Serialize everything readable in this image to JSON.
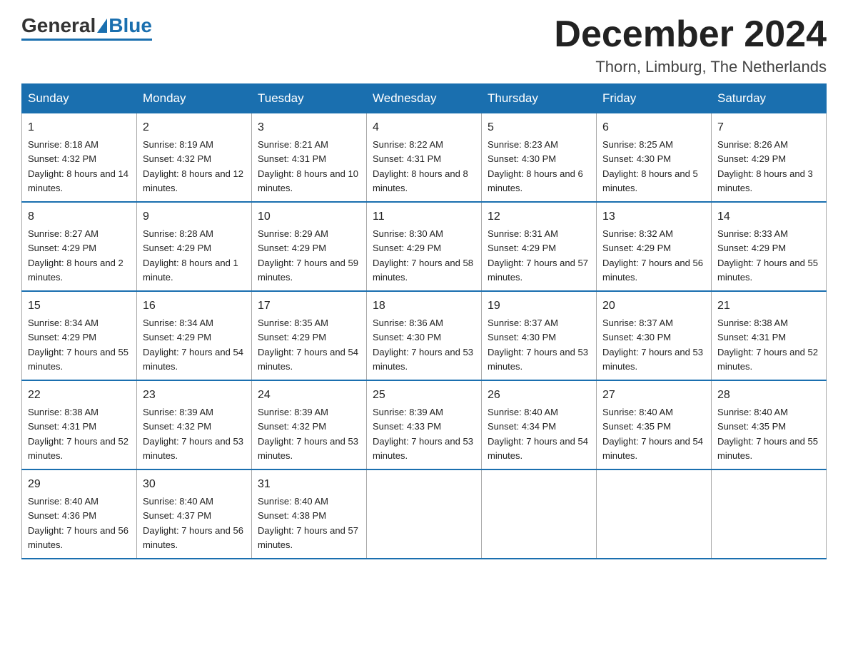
{
  "logo": {
    "text_general": "General",
    "text_blue": "Blue"
  },
  "header": {
    "month_year": "December 2024",
    "location": "Thorn, Limburg, The Netherlands"
  },
  "columns": [
    "Sunday",
    "Monday",
    "Tuesday",
    "Wednesday",
    "Thursday",
    "Friday",
    "Saturday"
  ],
  "weeks": [
    [
      {
        "day": "1",
        "sunrise": "8:18 AM",
        "sunset": "4:32 PM",
        "daylight": "8 hours and 14 minutes."
      },
      {
        "day": "2",
        "sunrise": "8:19 AM",
        "sunset": "4:32 PM",
        "daylight": "8 hours and 12 minutes."
      },
      {
        "day": "3",
        "sunrise": "8:21 AM",
        "sunset": "4:31 PM",
        "daylight": "8 hours and 10 minutes."
      },
      {
        "day": "4",
        "sunrise": "8:22 AM",
        "sunset": "4:31 PM",
        "daylight": "8 hours and 8 minutes."
      },
      {
        "day": "5",
        "sunrise": "8:23 AM",
        "sunset": "4:30 PM",
        "daylight": "8 hours and 6 minutes."
      },
      {
        "day": "6",
        "sunrise": "8:25 AM",
        "sunset": "4:30 PM",
        "daylight": "8 hours and 5 minutes."
      },
      {
        "day": "7",
        "sunrise": "8:26 AM",
        "sunset": "4:29 PM",
        "daylight": "8 hours and 3 minutes."
      }
    ],
    [
      {
        "day": "8",
        "sunrise": "8:27 AM",
        "sunset": "4:29 PM",
        "daylight": "8 hours and 2 minutes."
      },
      {
        "day": "9",
        "sunrise": "8:28 AM",
        "sunset": "4:29 PM",
        "daylight": "8 hours and 1 minute."
      },
      {
        "day": "10",
        "sunrise": "8:29 AM",
        "sunset": "4:29 PM",
        "daylight": "7 hours and 59 minutes."
      },
      {
        "day": "11",
        "sunrise": "8:30 AM",
        "sunset": "4:29 PM",
        "daylight": "7 hours and 58 minutes."
      },
      {
        "day": "12",
        "sunrise": "8:31 AM",
        "sunset": "4:29 PM",
        "daylight": "7 hours and 57 minutes."
      },
      {
        "day": "13",
        "sunrise": "8:32 AM",
        "sunset": "4:29 PM",
        "daylight": "7 hours and 56 minutes."
      },
      {
        "day": "14",
        "sunrise": "8:33 AM",
        "sunset": "4:29 PM",
        "daylight": "7 hours and 55 minutes."
      }
    ],
    [
      {
        "day": "15",
        "sunrise": "8:34 AM",
        "sunset": "4:29 PM",
        "daylight": "7 hours and 55 minutes."
      },
      {
        "day": "16",
        "sunrise": "8:34 AM",
        "sunset": "4:29 PM",
        "daylight": "7 hours and 54 minutes."
      },
      {
        "day": "17",
        "sunrise": "8:35 AM",
        "sunset": "4:29 PM",
        "daylight": "7 hours and 54 minutes."
      },
      {
        "day": "18",
        "sunrise": "8:36 AM",
        "sunset": "4:30 PM",
        "daylight": "7 hours and 53 minutes."
      },
      {
        "day": "19",
        "sunrise": "8:37 AM",
        "sunset": "4:30 PM",
        "daylight": "7 hours and 53 minutes."
      },
      {
        "day": "20",
        "sunrise": "8:37 AM",
        "sunset": "4:30 PM",
        "daylight": "7 hours and 53 minutes."
      },
      {
        "day": "21",
        "sunrise": "8:38 AM",
        "sunset": "4:31 PM",
        "daylight": "7 hours and 52 minutes."
      }
    ],
    [
      {
        "day": "22",
        "sunrise": "8:38 AM",
        "sunset": "4:31 PM",
        "daylight": "7 hours and 52 minutes."
      },
      {
        "day": "23",
        "sunrise": "8:39 AM",
        "sunset": "4:32 PM",
        "daylight": "7 hours and 53 minutes."
      },
      {
        "day": "24",
        "sunrise": "8:39 AM",
        "sunset": "4:32 PM",
        "daylight": "7 hours and 53 minutes."
      },
      {
        "day": "25",
        "sunrise": "8:39 AM",
        "sunset": "4:33 PM",
        "daylight": "7 hours and 53 minutes."
      },
      {
        "day": "26",
        "sunrise": "8:40 AM",
        "sunset": "4:34 PM",
        "daylight": "7 hours and 54 minutes."
      },
      {
        "day": "27",
        "sunrise": "8:40 AM",
        "sunset": "4:35 PM",
        "daylight": "7 hours and 54 minutes."
      },
      {
        "day": "28",
        "sunrise": "8:40 AM",
        "sunset": "4:35 PM",
        "daylight": "7 hours and 55 minutes."
      }
    ],
    [
      {
        "day": "29",
        "sunrise": "8:40 AM",
        "sunset": "4:36 PM",
        "daylight": "7 hours and 56 minutes."
      },
      {
        "day": "30",
        "sunrise": "8:40 AM",
        "sunset": "4:37 PM",
        "daylight": "7 hours and 56 minutes."
      },
      {
        "day": "31",
        "sunrise": "8:40 AM",
        "sunset": "4:38 PM",
        "daylight": "7 hours and 57 minutes."
      },
      null,
      null,
      null,
      null
    ]
  ],
  "labels": {
    "sunrise": "Sunrise:",
    "sunset": "Sunset:",
    "daylight": "Daylight:"
  }
}
